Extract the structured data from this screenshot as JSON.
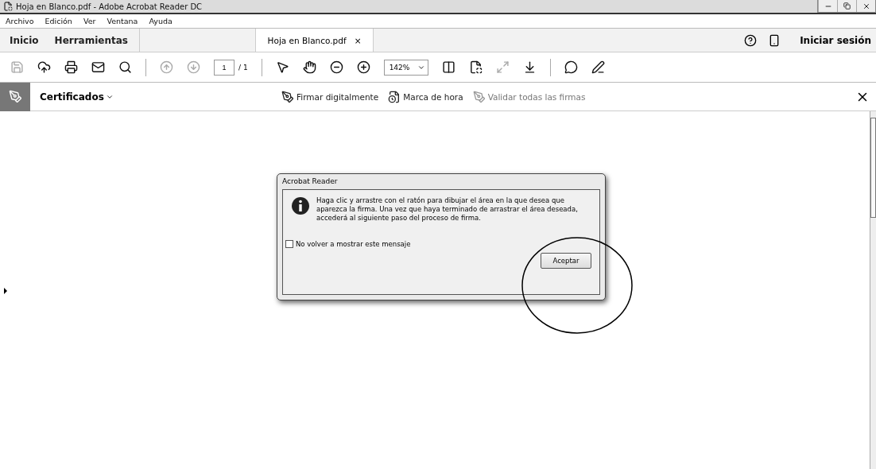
{
  "window": {
    "title": "Hoja en Blanco.pdf - Adobe Acrobat Reader DC"
  },
  "menu": [
    "Archivo",
    "Edición",
    "Ver",
    "Ventana",
    "Ayuda"
  ],
  "nav": [
    {
      "label": "Inicio",
      "selected": false
    },
    {
      "label": "Herramientas",
      "selected": false
    }
  ],
  "document_tab": {
    "label": "Hoja en Blanco.pdf",
    "close": "×",
    "selected": true
  },
  "sign_in": "Iniciar sesión",
  "toolbar": {
    "page": "1",
    "page_total": "/ 1",
    "zoom": "142%"
  },
  "tool_bar": {
    "name": "Certificados",
    "actions": [
      {
        "label": "Firmar digitalmente",
        "disabled": false,
        "kind": "pen"
      },
      {
        "label": "Marca de hora",
        "disabled": false,
        "kind": "clock"
      },
      {
        "label": "Validar todas las firmas",
        "disabled": true,
        "kind": "pen"
      }
    ]
  },
  "dialog": {
    "title": "Acrobat Reader",
    "message": "Haga clic y arrastre con el ratón para dibujar el área en la que desea que aparezca la firma. Una vez que haya terminado de arrastrar el área deseada, accederá al siguiente paso del proceso de firma.",
    "checkbox": {
      "label": "No volver a mostrar este mensaje",
      "checked": false
    },
    "button": "Aceptar"
  }
}
